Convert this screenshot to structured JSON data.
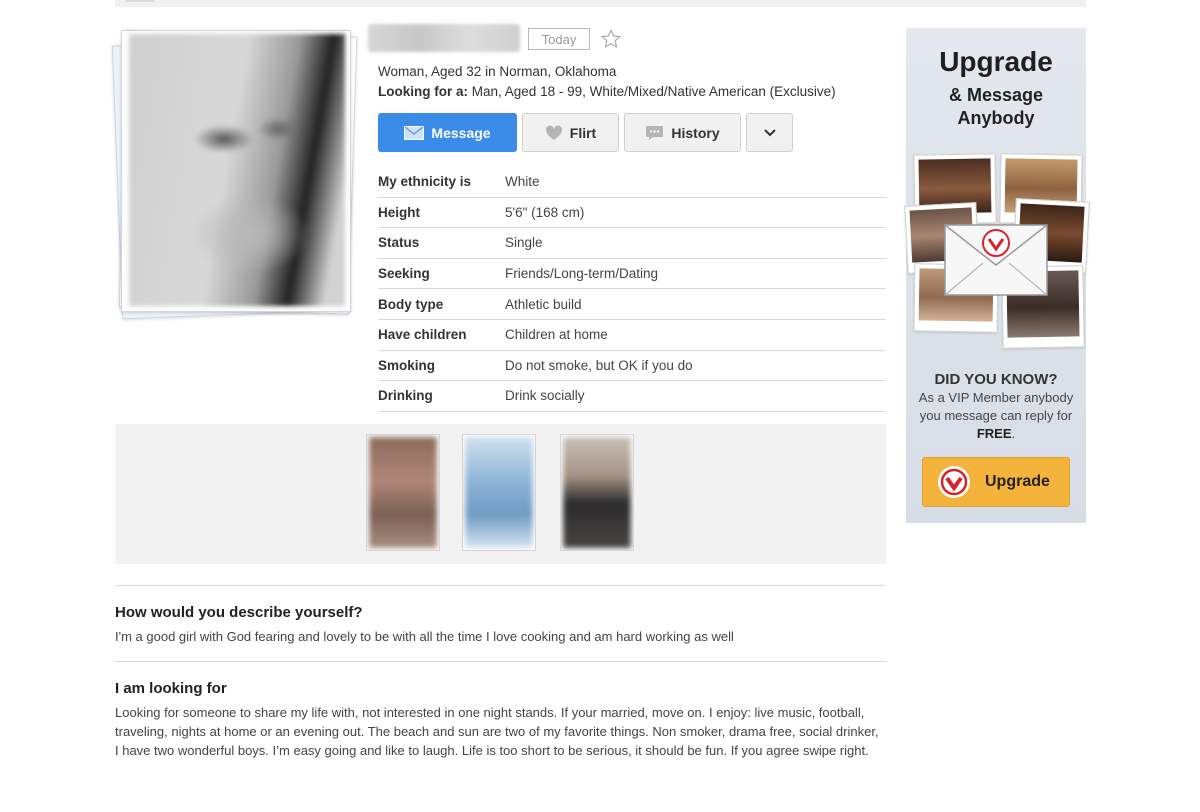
{
  "header": {
    "today_badge": "Today",
    "summary": "Woman, Aged 32 in Norman, Oklahoma",
    "looking_for_label": "Looking for a:",
    "looking_for_value": "Man, Aged 18 - 99, White/Mixed/Native American (Exclusive)"
  },
  "actions": {
    "message": "Message",
    "flirt": "Flirt",
    "history": "History"
  },
  "details": [
    {
      "label": "My ethnicity is",
      "value": "White"
    },
    {
      "label": "Height",
      "value": "5'6\" (168 cm)"
    },
    {
      "label": "Status",
      "value": "Single"
    },
    {
      "label": "Seeking",
      "value": "Friends/Long-term/Dating"
    },
    {
      "label": "Body type",
      "value": "Athletic build"
    },
    {
      "label": "Have children",
      "value": "Children at home"
    },
    {
      "label": "Smoking",
      "value": "Do not smoke, but OK if you do"
    },
    {
      "label": "Drinking",
      "value": "Drink socially"
    }
  ],
  "about": {
    "q1_title": "How would you describe yourself?",
    "q1_text": "I'm a good girl with God fearing and lovely to be with all the time I love cooking and am hard working as well",
    "q2_title": "I am looking for",
    "q2_text": "Looking for someone to share my life with, not interested in one night stands. If your married, move on. I enjoy: live music, football, traveling, nights at home or an evening out. The beach and sun are two of my favorite things. Non smoker, drama free, social drinker, I have two wonderful boys. I’m easy going and like to laugh. Life is too short to be serious, it should be fun. If you agree swipe right."
  },
  "ad": {
    "title": "Upgrade",
    "subtitle_line1": "& Message",
    "subtitle_line2": "Anybody",
    "did_you_know": "DID YOU KNOW?",
    "desc_prefix": "As a VIP Member anybody you message can reply for ",
    "desc_bold": "FREE",
    "desc_suffix": ".",
    "button": "Upgrade"
  },
  "colors": {
    "message_button": "#3b8be8",
    "upgrade_button": "#f4b33b",
    "brand_red": "#d8232a"
  },
  "icons": [
    "star-icon",
    "envelope-icon",
    "heart-icon",
    "chat-icon",
    "chevron-down-icon",
    "shield-check-icon"
  ]
}
